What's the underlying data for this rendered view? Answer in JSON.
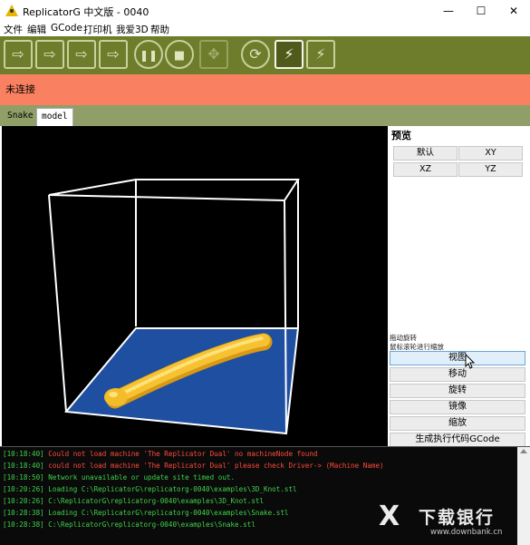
{
  "window": {
    "title": "ReplicatorG 中文版 - 0040",
    "minimize_glyph": "—",
    "maximize_glyph": "☐",
    "close_glyph": "✕"
  },
  "menu": [
    "文件",
    "编辑",
    "GCode",
    "打印机",
    "我爱3D",
    "帮助"
  ],
  "toolbar": {
    "buttons": [
      {
        "icon": "build-icon",
        "glyph": "⇨"
      },
      {
        "icon": "upload-icon",
        "glyph": "⇨"
      },
      {
        "icon": "build-to-file-icon",
        "glyph": "⇨"
      },
      {
        "icon": "build-to-sd-icon",
        "glyph": "⇨"
      },
      {
        "icon": "pause-icon",
        "glyph": "❚❚"
      },
      {
        "icon": "stop-icon",
        "glyph": "■"
      },
      {
        "icon": "control-panel-icon",
        "glyph": "✥"
      },
      {
        "icon": "reset-icon",
        "glyph": "⟳"
      },
      {
        "icon": "connect-icon",
        "glyph": "⚡"
      },
      {
        "icon": "disconnect-icon",
        "glyph": "⚡"
      }
    ]
  },
  "status": {
    "text": "未连接"
  },
  "tabs": [
    {
      "label": "Snake",
      "active": false
    },
    {
      "label": "model",
      "active": true
    }
  ],
  "side_panel": {
    "title": "预览",
    "view_buttons": [
      "默认",
      "XY",
      "XZ",
      "YZ"
    ],
    "hint_lines": [
      "拖动旋转",
      "鼠标滚轮进行缩放"
    ],
    "mode_buttons": [
      "视图",
      "移动",
      "旋转",
      "镜像",
      "缩放",
      "生成执行代码GCode"
    ],
    "selected_mode": "视图"
  },
  "console": {
    "lines": [
      {
        "time": "[10:18:40]",
        "text": "Could not load machine 'The Replicator Dual' no machineNode found",
        "level": "error"
      },
      {
        "time": "[10:18:40]",
        "text": "could not load machine 'The Replicator Dual' please check Driver-> (Machine Name)",
        "level": "error"
      },
      {
        "time": "[10:18:50]",
        "text": "Network unavailable or update site timed out.",
        "level": "info"
      },
      {
        "time": "[10:20:26]",
        "text": "Loading C:\\ReplicatorG\\replicatorg-0040\\examples\\3D_Knot.stl",
        "level": "info"
      },
      {
        "time": "[10:20:26]",
        "text": "C:\\ReplicatorG\\replicatorg-0040\\examples\\3D_Knot.stl",
        "level": "info"
      },
      {
        "time": "[10:28:38]",
        "text": "Loading C:\\ReplicatorG\\replicatorg-0040\\examples\\Snake.stl",
        "level": "info"
      },
      {
        "time": "[10:28:38]",
        "text": "C:\\ReplicatorG\\replicatorg-0040\\examples\\Snake.stl",
        "level": "info"
      }
    ]
  },
  "watermark": {
    "mark": "X",
    "name": "下载银行",
    "url": "www.downbank.cn"
  },
  "colors": {
    "toolbar": "#6e7d2b",
    "status_bar": "#f98161",
    "tab_bar": "#909f68",
    "build_plate": "#1f4fa0",
    "model": "#f6c232",
    "console_error": "#ff4a3a",
    "console_info": "#3fd24a",
    "console_time": "#3fd24a"
  }
}
